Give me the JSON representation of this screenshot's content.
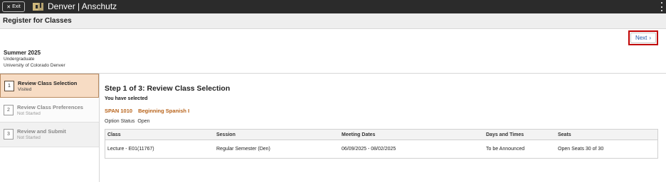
{
  "header": {
    "exit_label": "Exit",
    "brand": "Denver | Anschutz"
  },
  "page": {
    "title": "Register for Classes",
    "next_label": "Next"
  },
  "term": {
    "name": "Summer 2025",
    "career": "Undergraduate",
    "institution": "University of Colorado Denver"
  },
  "steps": [
    {
      "num": "1",
      "title": "Review Class Selection",
      "status": "Visited"
    },
    {
      "num": "2",
      "title": "Review Class Preferences",
      "status": "Not Started"
    },
    {
      "num": "3",
      "title": "Review and Submit",
      "status": "Not Started"
    }
  ],
  "main": {
    "heading": "Step 1 of 3: Review Class Selection",
    "you_selected": "You have selected",
    "course_code": "SPAN 1010",
    "course_title": "Beginning Spanish I",
    "option_status_label": "Option Status",
    "option_status_value": "Open"
  },
  "table": {
    "headers": [
      "Class",
      "Session",
      "Meeting Dates",
      "Days and Times",
      "Seats"
    ],
    "rows": [
      [
        "Lecture - E01(11767)",
        "Regular Semester (Den)",
        "06/09/2025 - 08/02/2025",
        "To be Announced",
        "Open Seats 30 of 30"
      ]
    ]
  },
  "colors": {
    "topbar": "#2b2b2b",
    "accent_link": "#1a56a8",
    "course_orange": "#b8631a",
    "highlight_box": "#c00000",
    "active_step_bg": "#f7dcc4"
  },
  "icons": [
    "close-icon",
    "cu-logo",
    "more-vertical-icon",
    "chevron-right-icon"
  ]
}
